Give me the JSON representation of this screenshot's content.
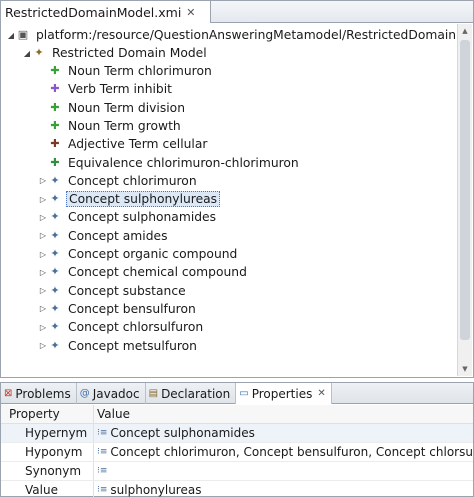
{
  "editor": {
    "tab_title": "RestrictedDomainModel.xmi",
    "tab_close": "✕"
  },
  "tree": {
    "root_label": "platform:/resource/QuestionAnsweringMetamodel/RestrictedDomainModel.xmi",
    "model_label": "Restricted Domain Model",
    "items": [
      {
        "label": "Noun Term chlorimuron",
        "kind": "noun"
      },
      {
        "label": "Verb Term inhibit",
        "kind": "verb"
      },
      {
        "label": "Noun Term division",
        "kind": "noun"
      },
      {
        "label": "Noun Term growth",
        "kind": "noun"
      },
      {
        "label": "Adjective Term cellular",
        "kind": "adj"
      },
      {
        "label": "Equivalence chlorimuron-chlorimuron",
        "kind": "equiv"
      },
      {
        "label": "Concept chlorimuron",
        "kind": "concept"
      },
      {
        "label": "Concept sulphonylureas",
        "kind": "concept",
        "selected": true
      },
      {
        "label": "Concept sulphonamides",
        "kind": "concept"
      },
      {
        "label": "Concept amides",
        "kind": "concept"
      },
      {
        "label": "Concept organic compound",
        "kind": "concept"
      },
      {
        "label": "Concept chemical compound",
        "kind": "concept"
      },
      {
        "label": "Concept substance",
        "kind": "concept"
      },
      {
        "label": "Concept bensulfuron",
        "kind": "concept"
      },
      {
        "label": "Concept chlorsulfuron",
        "kind": "concept"
      },
      {
        "label": "Concept metsulfuron",
        "kind": "concept"
      }
    ]
  },
  "panel": {
    "tabs": [
      {
        "label": "Problems",
        "icon": "problems-icon"
      },
      {
        "label": "Javadoc",
        "icon": "javadoc-icon"
      },
      {
        "label": "Declaration",
        "icon": "declaration-icon"
      },
      {
        "label": "Properties",
        "icon": "properties-icon",
        "active": true
      }
    ],
    "close_glyph": "✕"
  },
  "properties": {
    "header": {
      "property": "Property",
      "value": "Value"
    },
    "rows": [
      {
        "name": "Hypernym",
        "value": "Concept sulphonamides"
      },
      {
        "name": "Hyponym",
        "value": "Concept chlorimuron, Concept bensulfuron, Concept chlorsulfuron..."
      },
      {
        "name": "Synonym",
        "value": ""
      },
      {
        "name": "Value",
        "value": "sulphonylureas"
      }
    ]
  },
  "colors": {
    "selection_bg": "#dde8f6",
    "selection_border": "#4a74c9",
    "tab_bg": "#e4e8ee",
    "noun_icon": "#3aa03a",
    "verb_icon": "#8a56c8",
    "concept_icon": "#4a6f9a"
  }
}
